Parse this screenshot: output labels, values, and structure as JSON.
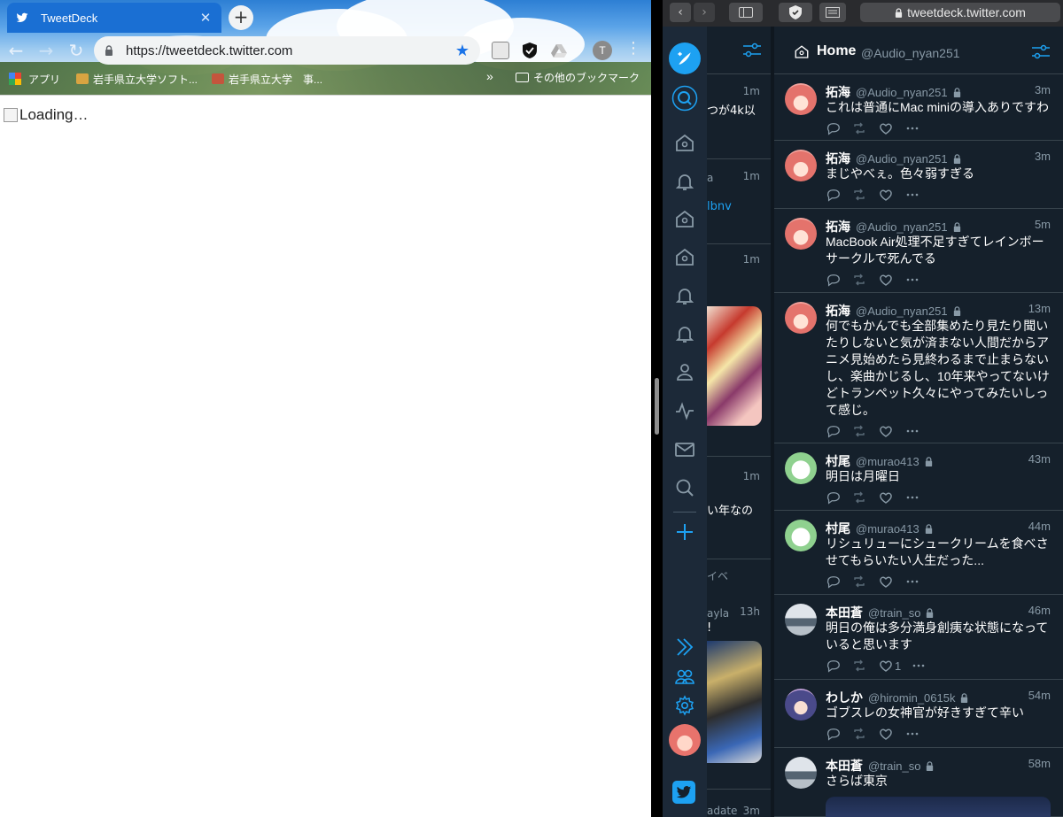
{
  "chrome": {
    "tab_title": "TweetDeck",
    "tab_close": "✕",
    "new_tab": "+",
    "nav": {
      "back": "←",
      "forward": "→",
      "reload": "↻"
    },
    "url": "https://tweetdeck.twitter.com",
    "star": "★",
    "profile_initial": "T",
    "menu": "⋮",
    "bookmarks": [
      {
        "label": "アプリ"
      },
      {
        "label": "岩手県立大学ソフト..."
      },
      {
        "label": "岩手県立大学　事..."
      }
    ],
    "bookmarks_more": "»",
    "other_bookmarks": "その他のブックマーク",
    "content_alt": "Loading…"
  },
  "safari": {
    "back": "‹",
    "forward": "›",
    "address": "tweetdeck.twitter.com"
  },
  "tweetdeck": {
    "column_count": "4",
    "left_column": {
      "items": [
        {
          "time": "1m",
          "text": "つが4k以",
          "name": ""
        },
        {
          "time": "1m",
          "text": "lbnv",
          "name": "a"
        },
        {
          "time": "1m",
          "text": "",
          "name": ""
        },
        {
          "time": "1m",
          "text": "い年なの",
          "name": ""
        },
        {
          "time": "",
          "text": "",
          "name": "イベ"
        },
        {
          "time": "13h",
          "text": "!",
          "name": "ayla"
        },
        {
          "time": "3m",
          "text": "",
          "name": "adate"
        }
      ]
    },
    "home_column": {
      "title": "Home",
      "handle": "@Audio_nyan251",
      "tweets": [
        {
          "name": "拓海",
          "handle": "@Audio_nyan251",
          "time": "3m",
          "text": "これは普通にMac miniの導入ありですわ",
          "likes": "",
          "avatar": "girl"
        },
        {
          "name": "拓海",
          "handle": "@Audio_nyan251",
          "time": "3m",
          "text": "まじやべぇ。色々弱すぎる",
          "likes": "",
          "avatar": "girl"
        },
        {
          "name": "拓海",
          "handle": "@Audio_nyan251",
          "time": "5m",
          "text": "MacBook Air処理不足すぎてレインボーサークルで死んでる",
          "likes": "",
          "avatar": "girl"
        },
        {
          "name": "拓海",
          "handle": "@Audio_nyan251",
          "time": "13m",
          "text": "何でもかんでも全部集めたり見たり聞いたりしないと気が済まない人間だからアニメ見始めたら見終わるまで止まらないし、楽曲かじるし、10年来やってないけどトランペット久々にやってみたいしって感じ。",
          "likes": "",
          "avatar": "girl"
        },
        {
          "name": "村尾",
          "handle": "@murao413",
          "time": "43m",
          "text": "明日は月曜日",
          "likes": "",
          "avatar": "cat"
        },
        {
          "name": "村尾",
          "handle": "@murao413",
          "time": "44m",
          "text": "リシュリューにシュークリームを食べさせてもらいたい人生だった...",
          "likes": "",
          "avatar": "cat"
        },
        {
          "name": "本田蒼",
          "handle": "@train_so",
          "time": "46m",
          "text": "明日の俺は多分満身創痍な状態になっていると思います",
          "likes": "1",
          "avatar": "train"
        },
        {
          "name": "わしか",
          "handle": "@hiromin_0615k",
          "time": "54m",
          "text": "ゴブスレの女神官が好きすぎて辛い",
          "likes": "",
          "avatar": "anime"
        },
        {
          "name": "本田蒼",
          "handle": "@train_so",
          "time": "58m",
          "text": "さらば東京",
          "likes": "",
          "avatar": "train"
        }
      ]
    }
  },
  "colors": {
    "td_background": "#15202b",
    "td_nav": "#1c2938",
    "accent": "#1da1f2",
    "chrome_tab": "#1a6fd3"
  }
}
